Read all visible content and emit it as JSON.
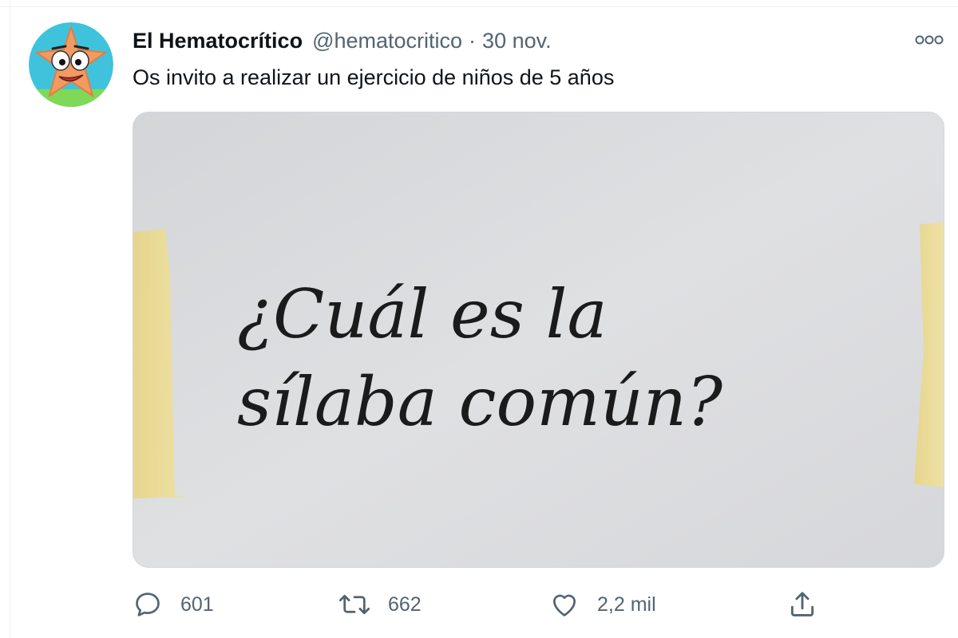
{
  "tweet": {
    "author": {
      "name": "El Hematocrítico",
      "handle": "@hematocritico",
      "avatar_icon": "cartoon-starfish-avatar"
    },
    "separator": "·",
    "date": "30 nov.",
    "text": "Os invito a realizar un ejercicio de niños de 5 años",
    "media": {
      "handwritten_line1": "¿Cuál es la",
      "handwritten_line2": "sílaba común?"
    },
    "actions": {
      "reply": {
        "icon": "reply-icon",
        "count": "601"
      },
      "retweet": {
        "icon": "retweet-icon",
        "count": "662"
      },
      "like": {
        "icon": "heart-icon",
        "count": "2,2 mil"
      },
      "share": {
        "icon": "share-icon"
      }
    },
    "more_icon": "more-options-icon"
  },
  "colors": {
    "text_primary": "#0f1419",
    "text_secondary": "#536471",
    "border": "#cfd9de"
  }
}
